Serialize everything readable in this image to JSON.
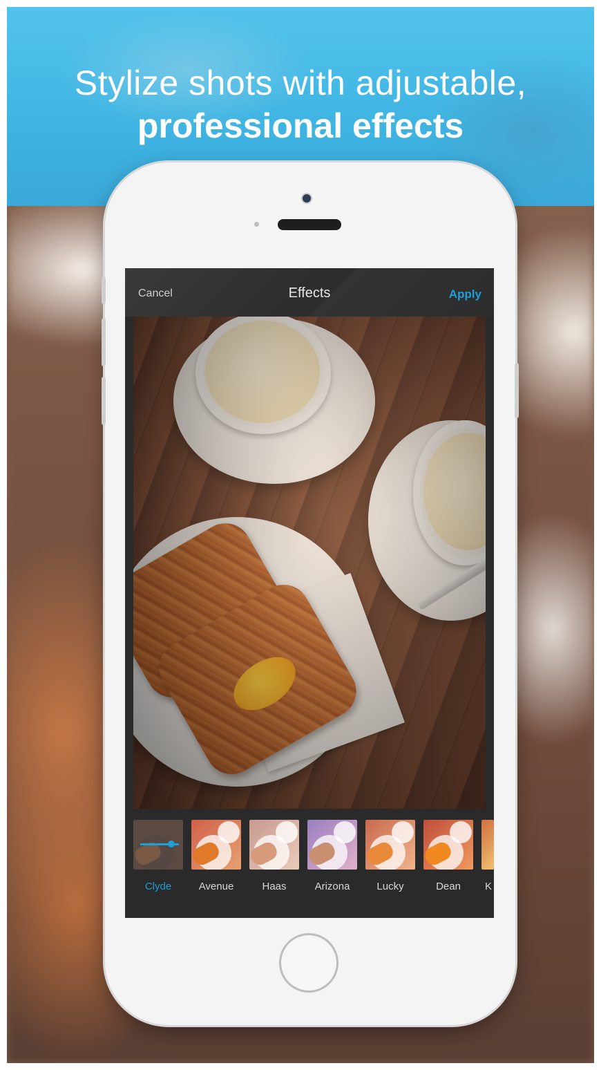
{
  "headline": {
    "line1": "Stylize shots with adjustable,",
    "line2": "professional effects"
  },
  "nav": {
    "cancel": "Cancel",
    "title": "Effects",
    "apply": "Apply"
  },
  "filters": [
    {
      "label": "Clyde",
      "selected": true
    },
    {
      "label": "Avenue",
      "selected": false
    },
    {
      "label": "Haas",
      "selected": false
    },
    {
      "label": "Arizona",
      "selected": false
    },
    {
      "label": "Lucky",
      "selected": false
    },
    {
      "label": "Dean",
      "selected": false
    },
    {
      "label": "K",
      "selected": false
    }
  ],
  "colors": {
    "accent": "#1e9fd8",
    "banner": "#52c3ec"
  }
}
